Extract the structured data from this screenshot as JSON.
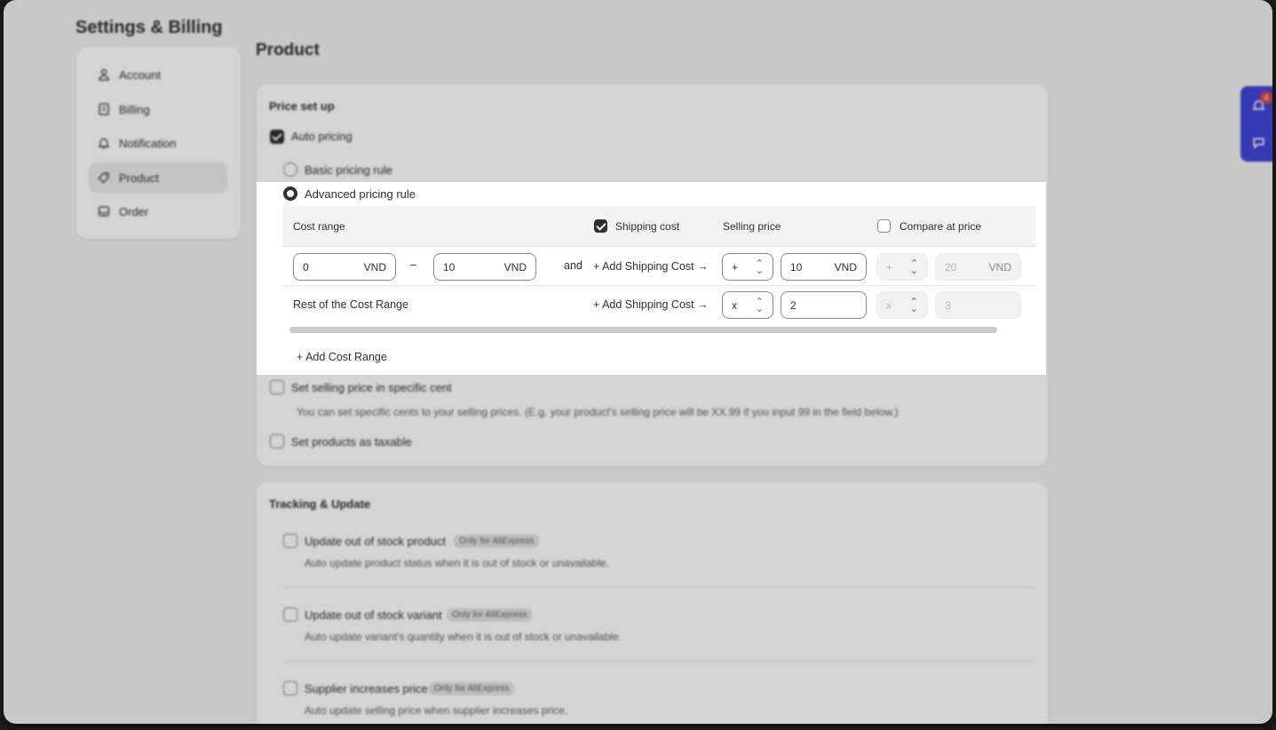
{
  "app": {
    "page_title": "Settings & Billing",
    "section_title": "Product"
  },
  "sidebar": {
    "items": [
      {
        "label": "Account",
        "icon": "user-icon"
      },
      {
        "label": "Billing",
        "icon": "receipt-icon"
      },
      {
        "label": "Notification",
        "icon": "bell-icon"
      },
      {
        "label": "Product",
        "icon": "tag-icon",
        "active": true
      },
      {
        "label": "Order",
        "icon": "inbox-icon"
      }
    ]
  },
  "price_setup": {
    "title": "Price set up",
    "auto_pricing": "Auto pricing",
    "basic_rule": "Basic pricing rule",
    "advanced_rule": "Advanced pricing rule",
    "table": {
      "col_cost_range": "Cost range",
      "col_shipping_cost": "Shipping cost",
      "col_selling_price": "Selling price",
      "col_compare_at": "Compare at price",
      "shipping_checked": true,
      "compare_checked": false
    },
    "row1": {
      "from": "0",
      "to": "10",
      "currency": "VND",
      "dash": "–",
      "and_text": "and",
      "add_shipping": "+ Add Shipping Cost →",
      "sell_op": "+",
      "sell_value": "10",
      "compare_op": "+",
      "compare_value": "20"
    },
    "row2": {
      "label": "Rest of the Cost Range",
      "add_shipping": "+ Add Shipping Cost →",
      "sell_op": "x",
      "sell_value": "2",
      "compare_op": "x",
      "compare_value": "3"
    },
    "add_cost_range": "+ Add Cost Range",
    "specific_cent": "Set selling price in specific cent",
    "specific_cent_help": "You can set specific cents to your selling prices. (E.g. your product's selling price will be XX.99 if you input 99 in the field below.)",
    "taxable": "Set products as taxable"
  },
  "tracking": {
    "title": "Tracking & Update",
    "only_aliexpress": "Only for AliExpress",
    "items": [
      {
        "label": "Update out of stock product",
        "desc": "Auto update product status when it is out of stock or unavailable."
      },
      {
        "label": "Update out of stock variant",
        "desc": "Auto update variant's quantity when it is out of stock or unavailable."
      },
      {
        "label": "Supplier increases price",
        "desc": "Auto update selling price when supplier increases price."
      }
    ]
  },
  "floating": {
    "badge_count": "4"
  }
}
